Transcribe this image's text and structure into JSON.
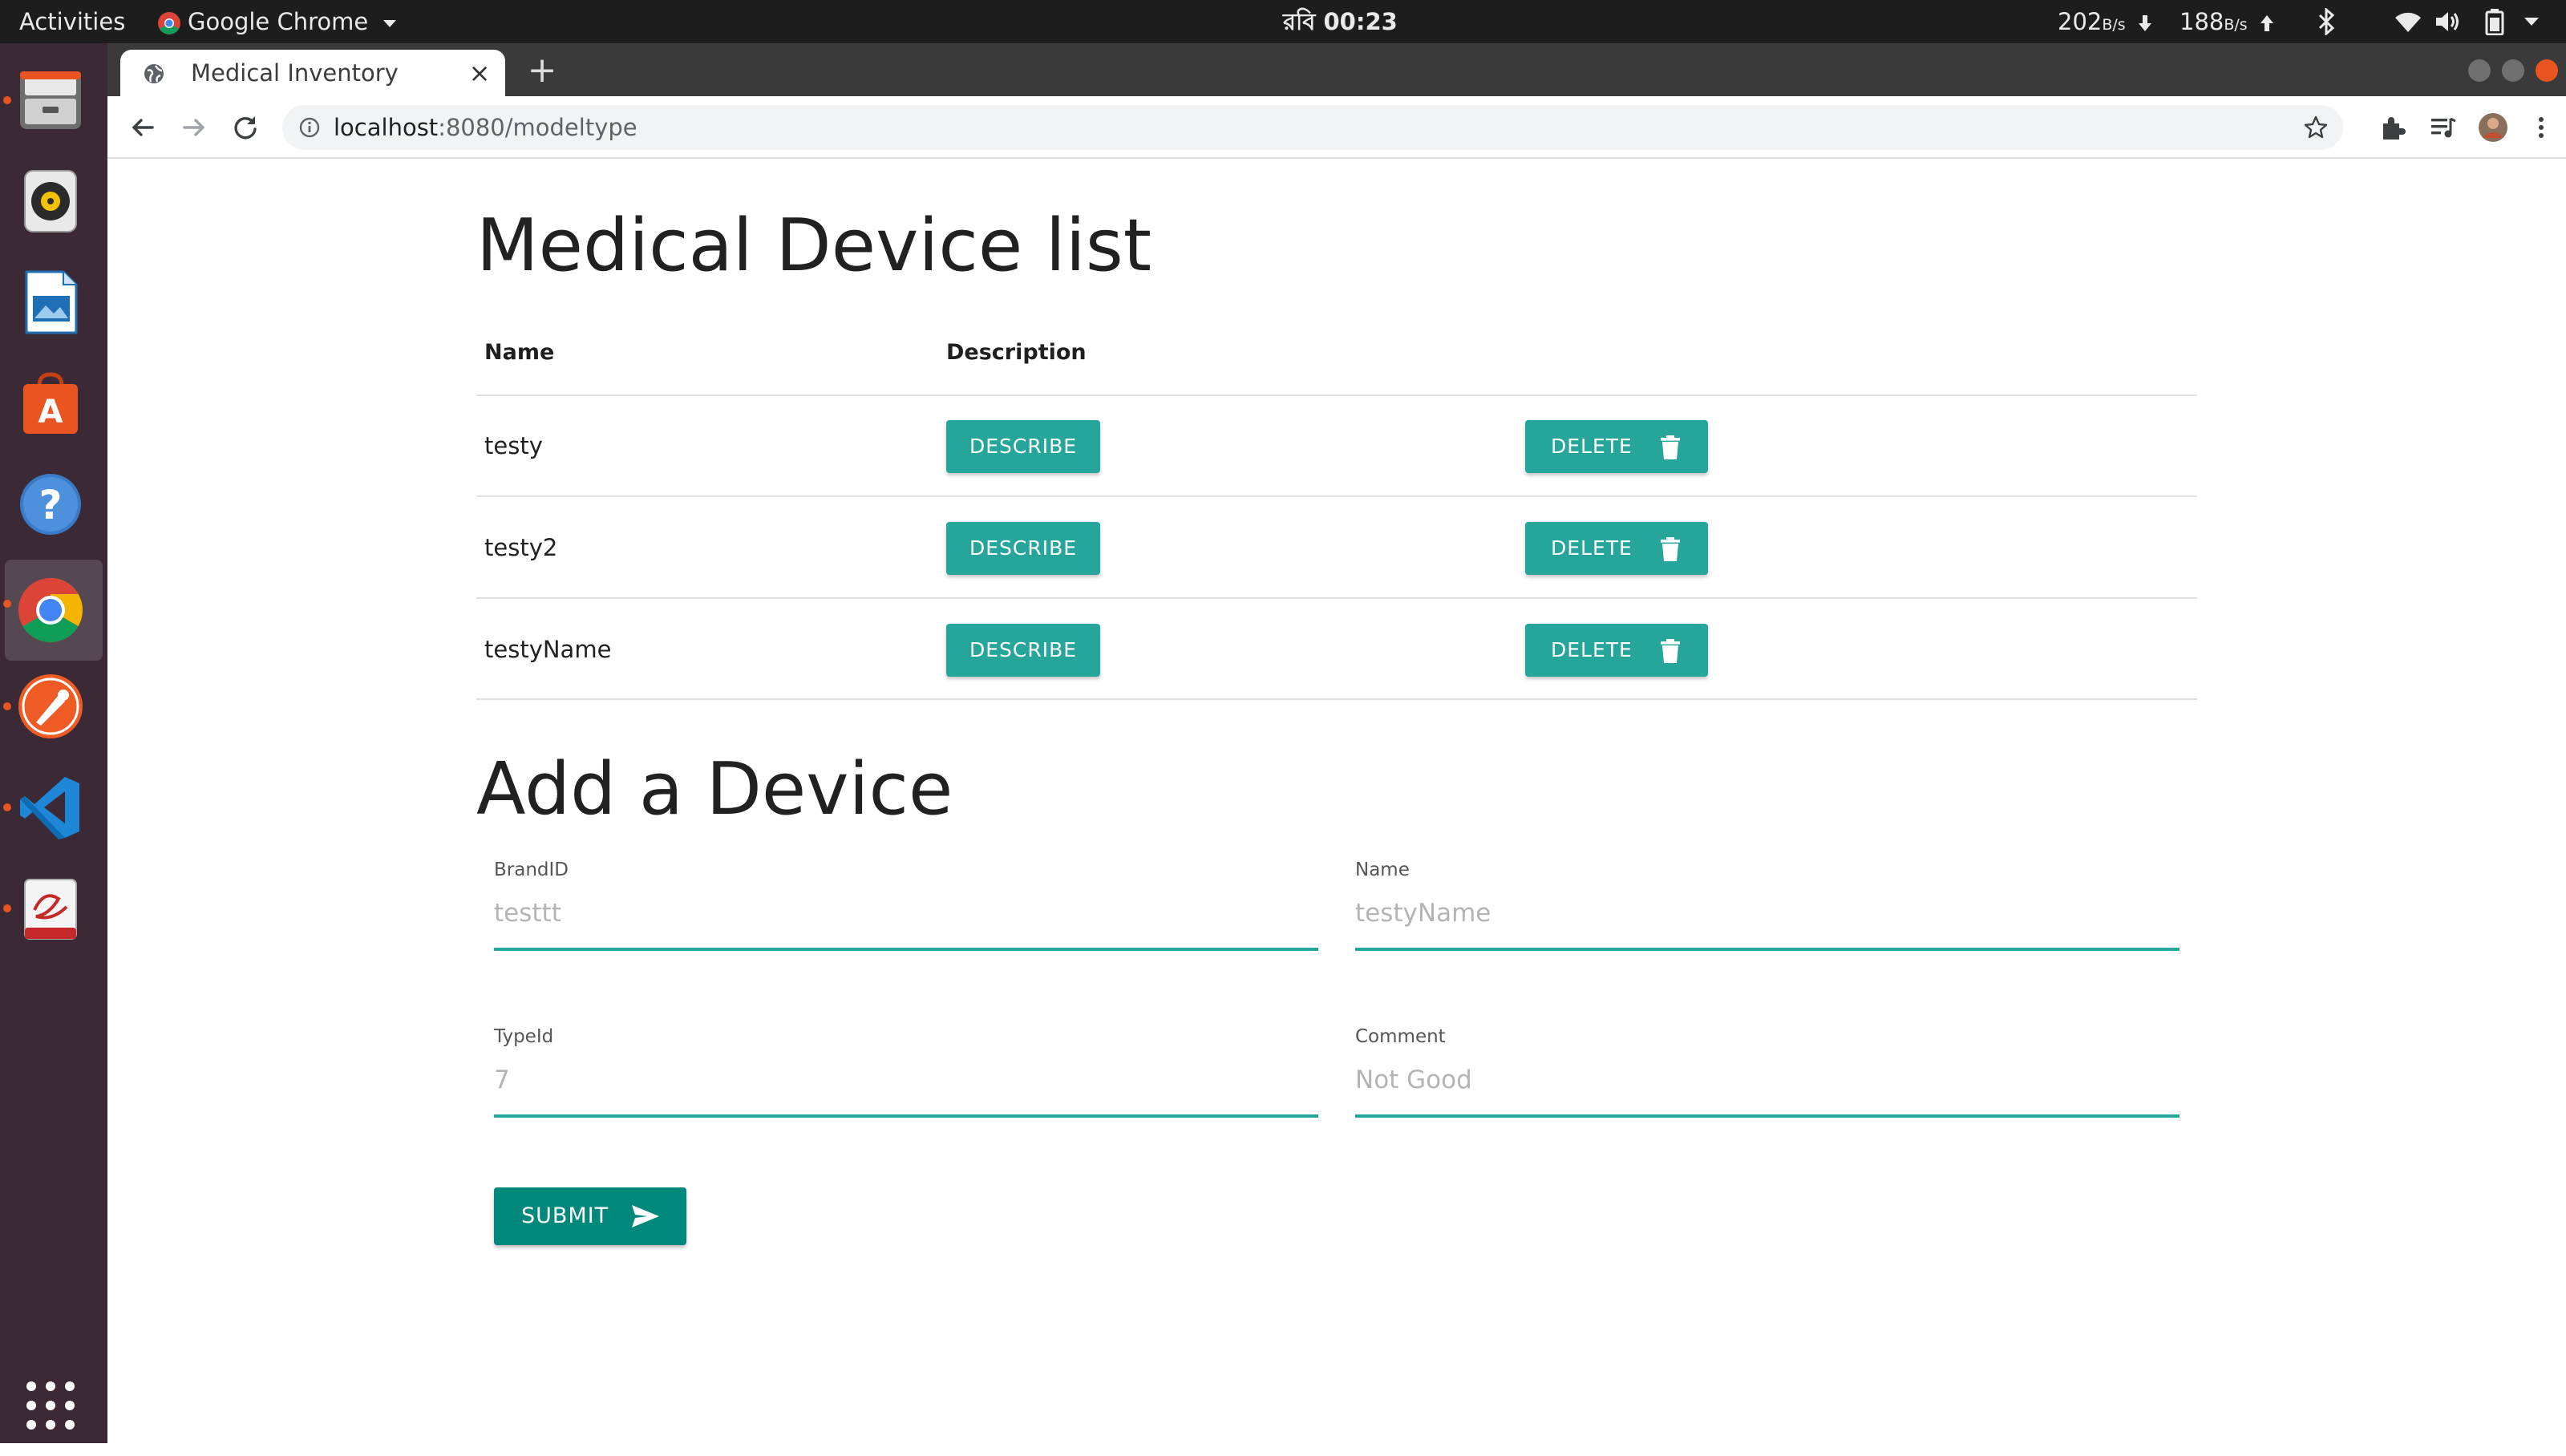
{
  "topbar": {
    "activities": "Activities",
    "app_name": "Google Chrome",
    "clock": "রবি 00:23",
    "net_down_value": "202",
    "net_down_unit": "B/s",
    "net_up_value": "188",
    "net_up_unit": "B/s"
  },
  "dock": {
    "items": [
      "files-icon",
      "rhythmbox-icon",
      "writer-icon",
      "software-icon",
      "help-icon",
      "chrome-icon",
      "postman-icon",
      "vscode-icon",
      "evince-icon",
      "apps-grid-icon"
    ]
  },
  "browser": {
    "tab_title": "Medical Inventory",
    "url_host": "localhost",
    "url_path": ":8080/modeltype"
  },
  "list": {
    "heading": "Medical Device list",
    "col_name": "Name",
    "col_description": "Description",
    "rows": [
      {
        "name": "testy",
        "describe_label": "DESCRIBE",
        "delete_label": "DELETE"
      },
      {
        "name": "testy2",
        "describe_label": "DESCRIBE",
        "delete_label": "DELETE"
      },
      {
        "name": "testyName",
        "describe_label": "DESCRIBE",
        "delete_label": "DELETE"
      }
    ]
  },
  "form": {
    "heading": "Add a Device",
    "brand_label": "BrandID",
    "brand_value": "testtt",
    "name_label": "Name",
    "name_value": "testyName",
    "type_label": "TypeId",
    "type_value": "7",
    "comment_label": "Comment",
    "comment_value": "Not Good",
    "submit_label": "SUBMIT"
  },
  "colors": {
    "accent": "#26a69a",
    "submit": "#00897b",
    "dock_bg": "#3b2a36",
    "topbar_bg": "#1d1d1d"
  }
}
